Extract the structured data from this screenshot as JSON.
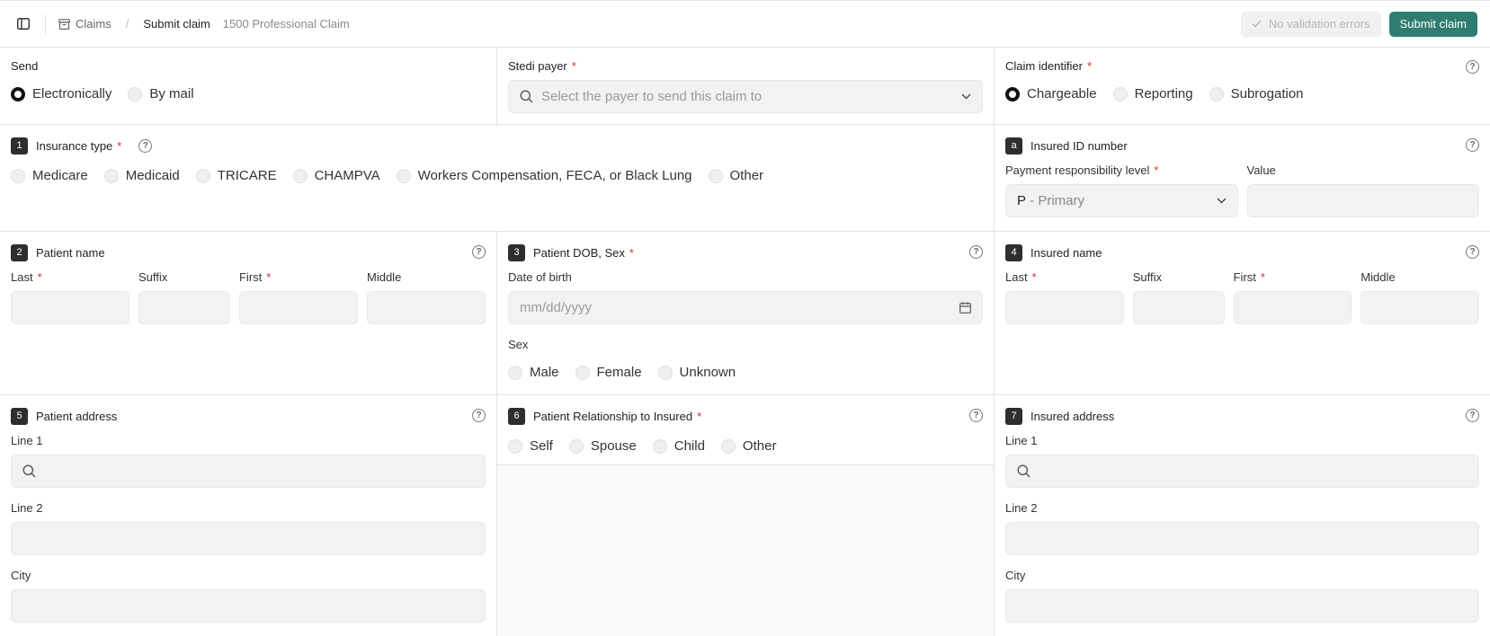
{
  "topbar": {
    "breadcrumb_claims": "Claims",
    "breadcrumb_current": "Submit claim",
    "breadcrumb_sub": "1500 Professional Claim",
    "validation_label": "No validation errors",
    "submit_label": "Submit claim"
  },
  "send": {
    "label": "Send",
    "options": [
      "Electronically",
      "By mail"
    ],
    "selected": "Electronically"
  },
  "payer": {
    "label": "Stedi payer",
    "placeholder": "Select the payer to send this claim to"
  },
  "claim_identifier": {
    "label": "Claim identifier",
    "options": [
      "Chargeable",
      "Reporting",
      "Subrogation"
    ],
    "selected": "Chargeable"
  },
  "insurance_type": {
    "num": "1",
    "label": "Insurance type",
    "options": [
      "Medicare",
      "Medicaid",
      "TRICARE",
      "CHAMPVA",
      "Workers Compensation, FECA, or Black Lung",
      "Other"
    ]
  },
  "insured_id": {
    "num": "a",
    "label": "Insured ID number",
    "payment_label": "Payment responsibility level",
    "payment_code": "P",
    "payment_value": " - Primary",
    "value_label": "Value"
  },
  "patient_name": {
    "num": "2",
    "label": "Patient name",
    "fields": [
      "Last",
      "Suffix",
      "First",
      "Middle"
    ]
  },
  "patient_dob": {
    "num": "3",
    "label": "Patient DOB, Sex",
    "dob_label": "Date of birth",
    "dob_placeholder": "mm/dd/yyyy",
    "sex_label": "Sex",
    "sex_options": [
      "Male",
      "Female",
      "Unknown"
    ]
  },
  "insured_name": {
    "num": "4",
    "label": "Insured name",
    "fields": [
      "Last",
      "Suffix",
      "First",
      "Middle"
    ]
  },
  "patient_address": {
    "num": "5",
    "label": "Patient address",
    "line1": "Line 1",
    "line2": "Line 2",
    "city": "City"
  },
  "relationship": {
    "num": "6",
    "label": "Patient Relationship to Insured",
    "options": [
      "Self",
      "Spouse",
      "Child",
      "Other"
    ]
  },
  "insured_address": {
    "num": "7",
    "label": "Insured address",
    "line1": "Line 1",
    "line2": "Line 2",
    "city": "City"
  },
  "colors": {
    "accent": "#2f7d70",
    "required": "#d93025"
  }
}
